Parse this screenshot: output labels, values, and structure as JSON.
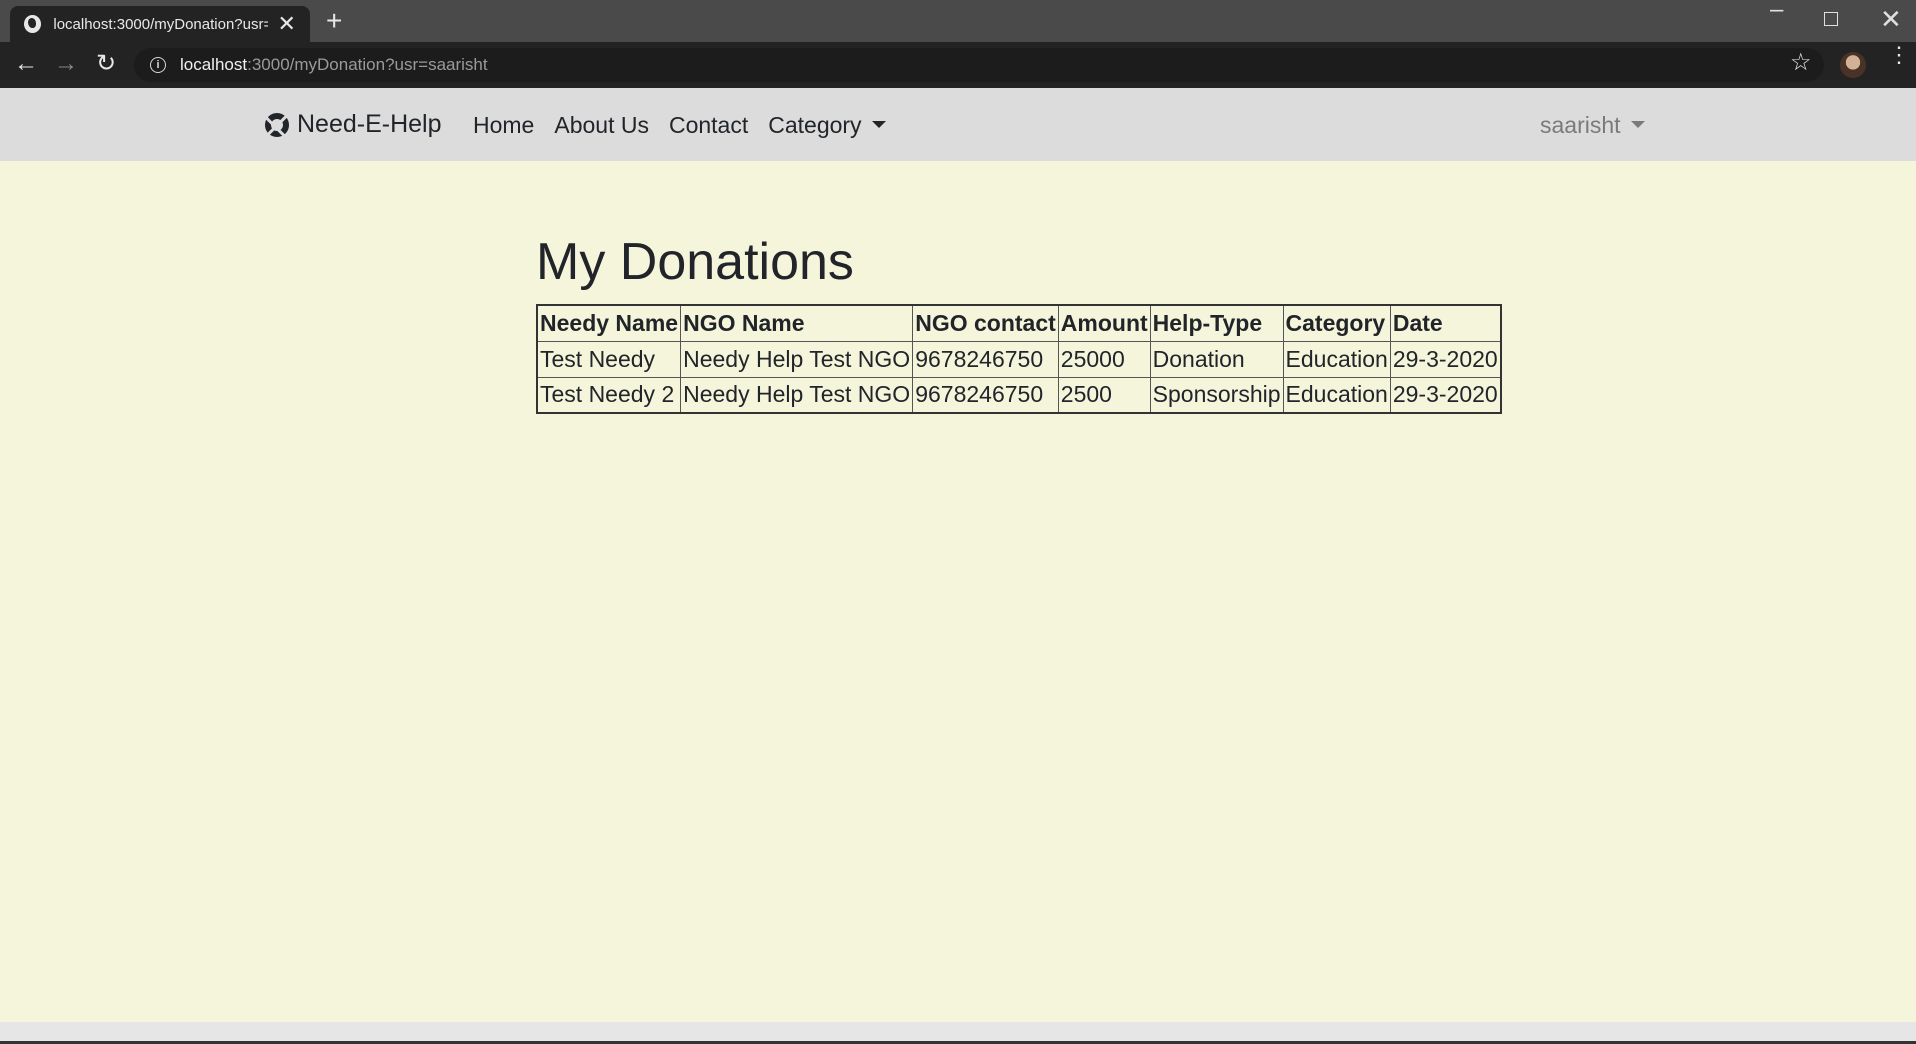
{
  "browser": {
    "tab_title": "localhost:3000/myDonation?usr=",
    "tab_close": "✕",
    "new_tab": "+",
    "url_host": "localhost",
    "url_rest": ":3000/myDonation?usr=saarisht",
    "icons": {
      "back": "←",
      "forward": "→",
      "reload": "↻",
      "info": "i",
      "star": "☆",
      "menu": "⋮",
      "minimize": "–",
      "close": "✕"
    }
  },
  "navbar": {
    "brand": "Need-E-Help",
    "links": [
      "Home",
      "About Us",
      "Contact",
      "Category"
    ],
    "user": "saarisht"
  },
  "main": {
    "title": "My Donations",
    "table": {
      "headers": [
        "Needy Name",
        "NGO Name",
        "NGO contact",
        "Amount",
        "Help-Type",
        "Category",
        "Date"
      ],
      "rows": [
        [
          "Test Needy",
          "Needy Help Test NGO",
          "9678246750",
          "25000",
          "Donation",
          "Education",
          "29-3-2020"
        ],
        [
          "Test Needy 2",
          "Needy Help Test NGO",
          "9678246750",
          "2500",
          "Sponsorship",
          "Education",
          "29-3-2020"
        ]
      ]
    }
  }
}
